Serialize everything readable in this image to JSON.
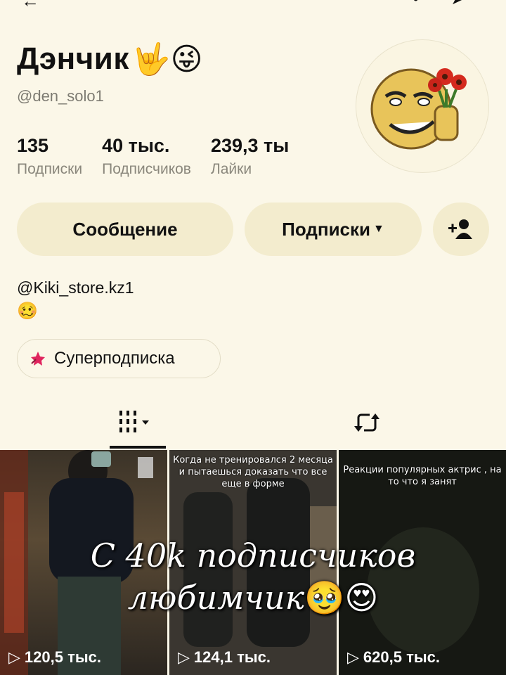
{
  "profile": {
    "display_name": "Дэнчик",
    "name_emojis": "🤟😜",
    "username": "@den_solo1"
  },
  "stats": [
    {
      "value": "135",
      "label": "Подписки"
    },
    {
      "value": "40 тыс.",
      "label": "Подписчиков"
    },
    {
      "value": "239,3 ты",
      "label": "Лайки"
    }
  ],
  "actions": {
    "message_label": "Сообщение",
    "following_label": "Подписки"
  },
  "bio": {
    "link": "@Kiki_store.kz1",
    "emoji": "🥴"
  },
  "super_follow": {
    "label": "Суперподписка"
  },
  "videos": [
    {
      "views": "120,5 тыс.",
      "caption": ""
    },
    {
      "views": "124,1 тыс.",
      "caption": "Когда не тренировался 2 месяца и пытаешься доказать что все еще в форме"
    },
    {
      "views": "620,5 тыс.",
      "caption": "Реакции популярных актрис , на то что я занят"
    }
  ],
  "overlay": {
    "line1": "С 40k подписчиков",
    "line2": "любимчик",
    "emojis": "🥹😍"
  },
  "colors": {
    "background": "#fbf7e8",
    "button_bg": "#f3ecce",
    "muted_text": "#8a877c"
  }
}
